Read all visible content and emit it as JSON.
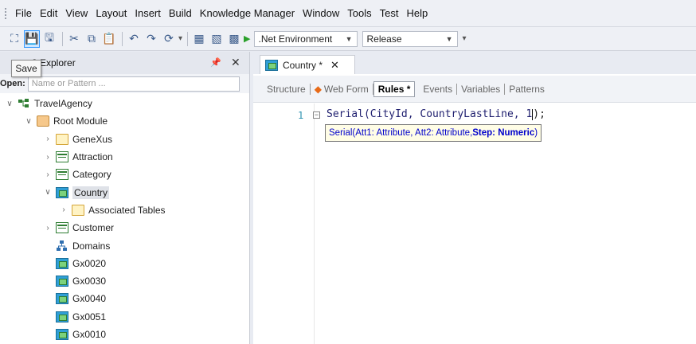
{
  "menu": [
    "File",
    "Edit",
    "View",
    "Layout",
    "Insert",
    "Build",
    "Knowledge Manager",
    "Window",
    "Tools",
    "Test",
    "Help"
  ],
  "toolbar": {
    "environment": ".Net Environment",
    "configuration": "Release"
  },
  "tooltip": {
    "save": "Save"
  },
  "explorer": {
    "title": "3 Explorer",
    "open_label": "Open:",
    "open_placeholder": "Name or Pattern ...",
    "tree": [
      {
        "label": "TravelAgency",
        "level": 0,
        "expander": "v",
        "icon": "kb-icon"
      },
      {
        "label": "Root Module",
        "level": 1,
        "expander": "v",
        "icon": "module-icon"
      },
      {
        "label": "GeneXus",
        "level": 2,
        "expander": ">",
        "icon": "folder-icon"
      },
      {
        "label": "Attraction",
        "level": 2,
        "expander": ">",
        "icon": "table-icon"
      },
      {
        "label": "Category",
        "level": 2,
        "expander": ">",
        "icon": "table-icon"
      },
      {
        "label": "Country",
        "level": 2,
        "expander": "v",
        "icon": "table-icon",
        "selected": true
      },
      {
        "label": "Associated Tables",
        "level": 3,
        "expander": ">",
        "icon": "folder-icon"
      },
      {
        "label": "Customer",
        "level": 2,
        "expander": ">",
        "icon": "table-icon"
      },
      {
        "label": "Domains",
        "level": 2,
        "expander": "",
        "icon": "domain-icon"
      },
      {
        "label": "Gx0020",
        "level": 2,
        "expander": "",
        "icon": "webpanel-icon"
      },
      {
        "label": "Gx0030",
        "level": 2,
        "expander": "",
        "icon": "webpanel-icon"
      },
      {
        "label": "Gx0040",
        "level": 2,
        "expander": "",
        "icon": "webpanel-icon"
      },
      {
        "label": "Gx0051",
        "level": 2,
        "expander": "",
        "icon": "webpanel-icon"
      },
      {
        "label": "Gx0010",
        "level": 2,
        "expander": "",
        "icon": "webpanel-icon"
      }
    ]
  },
  "editor": {
    "tab_title": "Country *",
    "subtabs": [
      "Structure",
      "Web Form",
      "Rules *",
      "Events",
      "Variables",
      "Patterns"
    ],
    "active_subtab": "Rules *",
    "line_number": "1",
    "code": {
      "before_caret": "Serial(CityId, CountryLastLine, 1",
      "after_caret": ");"
    },
    "signature": {
      "prefix": "Serial(Att1: Attribute, Att2: Attribute, ",
      "bold": "Step: Numeric",
      "suffix": ")"
    }
  }
}
